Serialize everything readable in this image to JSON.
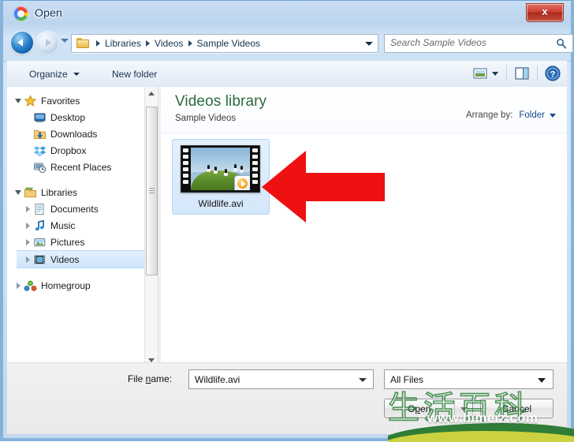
{
  "window": {
    "title": "Open",
    "app_icon": "chrome-icon",
    "close_label": "x",
    "accent_blue": "#3f73ad",
    "title_color": "#13314f"
  },
  "nav": {
    "back_icon": "back-arrow-icon",
    "forward_icon": "forward-arrow-icon",
    "history_icon": "chevron-down-icon",
    "refresh_icon": "refresh-icon",
    "breadcrumbs": [
      "Libraries",
      "Videos",
      "Sample Videos"
    ],
    "address_dropdown_icon": "chevron-down-icon"
  },
  "search": {
    "placeholder": "Search Sample Videos",
    "icon": "search-icon"
  },
  "toolbar": {
    "organize_label": "Organize",
    "new_folder_label": "New folder",
    "view_icon": "view-mode-icon",
    "view_caret_icon": "chevron-down-icon",
    "preview_pane_icon": "preview-pane-icon",
    "help_icon": "help-icon",
    "help_label": "?"
  },
  "sidebar": {
    "groups": [
      {
        "label": "Favorites",
        "icon": "star-icon",
        "expanded": true,
        "children": [
          {
            "label": "Desktop",
            "icon": "desktop-icon"
          },
          {
            "label": "Downloads",
            "icon": "downloads-folder-icon"
          },
          {
            "label": "Dropbox",
            "icon": "dropbox-icon"
          },
          {
            "label": "Recent Places",
            "icon": "recent-places-icon"
          }
        ]
      },
      {
        "label": "Libraries",
        "icon": "libraries-icon",
        "expanded": true,
        "children": [
          {
            "label": "Documents",
            "icon": "documents-icon"
          },
          {
            "label": "Music",
            "icon": "music-note-icon"
          },
          {
            "label": "Pictures",
            "icon": "pictures-icon"
          },
          {
            "label": "Videos",
            "icon": "video-filmstrip-icon",
            "selected": true
          }
        ]
      },
      {
        "label": "Homegroup",
        "icon": "homegroup-icon",
        "expanded": false,
        "children": []
      }
    ],
    "scrollbar": {
      "up_icon": "scroll-up-icon",
      "down_icon": "scroll-down-icon",
      "thumb_icon": "scrollbar-thumb"
    }
  },
  "content": {
    "library_title": "Videos library",
    "library_subtitle": "Sample Videos",
    "library_title_color": "#2b6b3f",
    "arrange_label": "Arrange by:",
    "arrange_value": "Folder",
    "arrange_caret_icon": "chevron-down-icon",
    "files": [
      {
        "name": "Wildlife.avi",
        "icon": "video-thumbnail",
        "badge": "play-badge-icon",
        "selected": true
      }
    ]
  },
  "annotation": {
    "arrow_icon": "red-left-arrow",
    "arrow_color": "#ee1111",
    "direction": "left"
  },
  "footer": {
    "file_name_label_pre": "File ",
    "file_name_label_accel": "n",
    "file_name_label_post": "ame:",
    "file_name_value": "Wildlife.avi",
    "file_name_dropdown_icon": "chevron-down-icon",
    "file_type_value": "All Files",
    "file_type_dropdown_icon": "chevron-down-icon",
    "open_label_pre": "O",
    "open_label_accel": "p",
    "open_label_post": "en",
    "open_dropdown_icon": "chevron-down-icon",
    "cancel_label": "Cancel"
  },
  "watermark": {
    "chinese_text": "生活百科",
    "url": "www.bimeiz.com",
    "color": "#2d843a"
  }
}
